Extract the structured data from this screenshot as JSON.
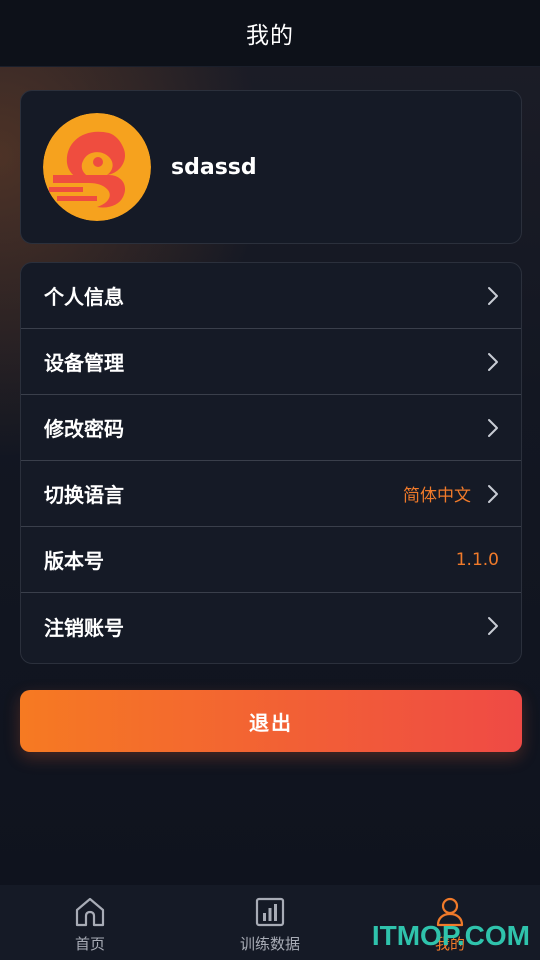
{
  "header": {
    "title": "我的"
  },
  "profile": {
    "username": "sdassd"
  },
  "menu": {
    "items": [
      {
        "label": "个人信息",
        "value": ""
      },
      {
        "label": "设备管理",
        "value": ""
      },
      {
        "label": "修改密码",
        "value": ""
      },
      {
        "label": "切换语言",
        "value": "简体中文"
      },
      {
        "label": "版本号",
        "value": "1.1.0"
      },
      {
        "label": "注销账号",
        "value": ""
      }
    ]
  },
  "actions": {
    "logout_label": "退出"
  },
  "bottom_nav": {
    "items": [
      {
        "label": "首页",
        "icon": "home-icon"
      },
      {
        "label": "训练数据",
        "icon": "bar-chart-icon"
      },
      {
        "label": "我的",
        "icon": "user-icon",
        "active": true
      }
    ]
  },
  "watermark": {
    "text": "ITMOP.COM"
  },
  "colors": {
    "accent": "#f07a2a",
    "button_gradient_start": "#f67a22",
    "button_gradient_end": "#ef4a45",
    "background": "#101420",
    "card": "#151a26"
  }
}
